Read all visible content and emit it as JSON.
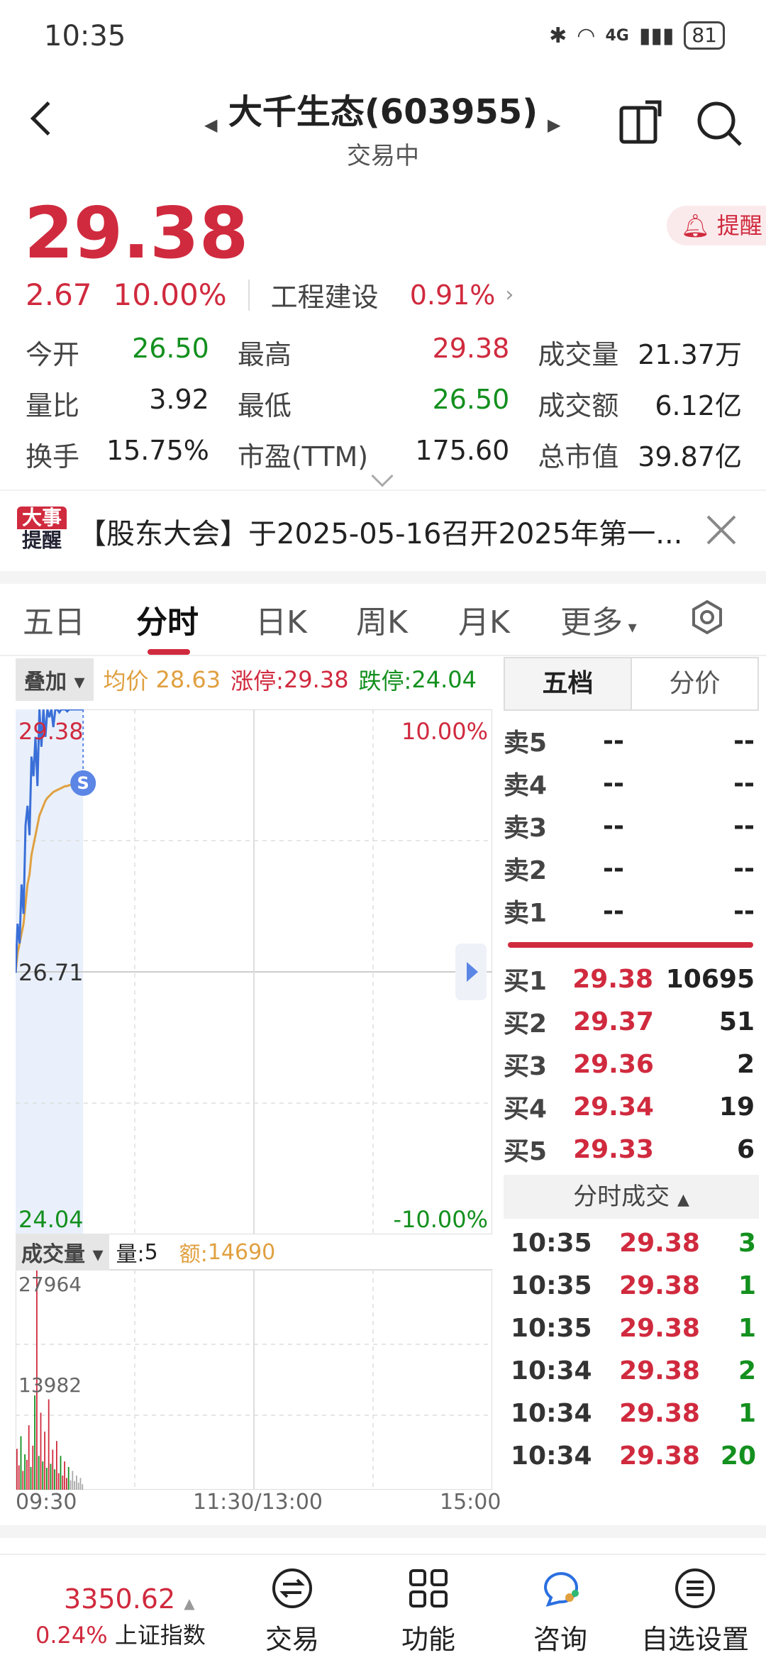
{
  "status_bar": {
    "time": "10:35",
    "network": "4G",
    "battery": "81"
  },
  "header": {
    "stock_name": "大千生态(603955)",
    "status": "交易中"
  },
  "quote": {
    "price": "29.38",
    "change": "2.67",
    "change_pct": "10.00%",
    "sector_name": "工程建设",
    "sector_pct": "0.91%",
    "alert_label": "提醒",
    "stats": [
      {
        "l1": "今开",
        "v1": "26.50",
        "l2": "最高",
        "v2": "29.38",
        "l3": "成交量",
        "v3": "21.37万"
      },
      {
        "l1": "量比",
        "v1": "3.92",
        "l2": "最低",
        "v2": "26.50",
        "l3": "成交额",
        "v3": "6.12亿"
      },
      {
        "l1": "换手",
        "v1": "15.75%",
        "l2": "市盈(TTM)",
        "v2": "175.60",
        "l3": "总市值",
        "v3": "39.87亿"
      }
    ]
  },
  "news": {
    "badge_top": "大事",
    "badge_bottom": "提醒",
    "text": "【股东大会】于2025-05-16召开2025年第一..."
  },
  "tabs": [
    "五日",
    "分时",
    "日K",
    "周K",
    "月K",
    "更多"
  ],
  "chart_info": {
    "stack_label": "叠加",
    "avg_label": "均价",
    "avg": "28.63",
    "limit_up_label": "涨停:",
    "limit_up": "29.38",
    "limit_down_label": "跌停:",
    "limit_down": "24.04"
  },
  "chart_data": {
    "type": "line",
    "y_labels": {
      "top": "29.38",
      "mid": "26.71",
      "bottom": "24.04",
      "top_pct": "10.00%",
      "bottom_pct": "-10.00%"
    },
    "ylim": [
      24.04,
      29.38
    ],
    "price": [
      26.7,
      27.2,
      27.0,
      27.6,
      27.3,
      28.2,
      28.4,
      28.1,
      28.9,
      28.7,
      29.1,
      28.6,
      29.38,
      29.0,
      29.38,
      29.1,
      29.38,
      29.3,
      29.38,
      29.2,
      29.38,
      29.38,
      29.35,
      29.38,
      29.38,
      29.38,
      29.36,
      29.38,
      29.38,
      29.38,
      29.38,
      29.38,
      29.38,
      29.38,
      29.38
    ],
    "avg": [
      26.7,
      26.9,
      27.0,
      27.1,
      27.2,
      27.4,
      27.6,
      27.7,
      27.9,
      28.0,
      28.1,
      28.2,
      28.3,
      28.35,
      28.4,
      28.45,
      28.48,
      28.5,
      28.52,
      28.54,
      28.55,
      28.56,
      28.57,
      28.58,
      28.59,
      28.6,
      28.6,
      28.61,
      28.61,
      28.62,
      28.62,
      28.62,
      28.63,
      28.63,
      28.63
    ],
    "marker": "S",
    "volume_label": "成交量",
    "vol_label": "量:",
    "vol": "5",
    "amount_label": "额:",
    "amount": "14690",
    "vol_max_label": "27964",
    "vol_mid_label": "13982",
    "vol_ylim": [
      0,
      27964
    ],
    "volumes": [
      5200,
      3100,
      6800,
      2400,
      4500,
      3800,
      8200,
      2900,
      5600,
      12000,
      27964,
      4300,
      9800,
      3600,
      7400,
      2800,
      11500,
      3300,
      5100,
      2600,
      6200,
      2100,
      4300,
      1800,
      3600,
      1500,
      2900,
      1200,
      2400,
      1100,
      1800,
      900,
      1500,
      700,
      5
    ],
    "time_labels": [
      "09:30",
      "11:30/13:00",
      "15:00"
    ]
  },
  "orderbook": {
    "tab_active": "五档",
    "tab_other": "分价",
    "asks": [
      {
        "label": "卖5",
        "price": "--",
        "vol": "--"
      },
      {
        "label": "卖4",
        "price": "--",
        "vol": "--"
      },
      {
        "label": "卖3",
        "price": "--",
        "vol": "--"
      },
      {
        "label": "卖2",
        "price": "--",
        "vol": "--"
      },
      {
        "label": "卖1",
        "price": "--",
        "vol": "--"
      }
    ],
    "bids": [
      {
        "label": "买1",
        "price": "29.38",
        "vol": "10695"
      },
      {
        "label": "买2",
        "price": "29.37",
        "vol": "51"
      },
      {
        "label": "买3",
        "price": "29.36",
        "vol": "2"
      },
      {
        "label": "买4",
        "price": "29.34",
        "vol": "19"
      },
      {
        "label": "买5",
        "price": "29.33",
        "vol": "6"
      }
    ],
    "ticks_header": "分时成交",
    "ticks": [
      {
        "time": "10:35",
        "price": "29.38",
        "vol": "3"
      },
      {
        "time": "10:35",
        "price": "29.38",
        "vol": "1"
      },
      {
        "time": "10:35",
        "price": "29.38",
        "vol": "1"
      },
      {
        "time": "10:34",
        "price": "29.38",
        "vol": "2"
      },
      {
        "time": "10:34",
        "price": "29.38",
        "vol": "1"
      },
      {
        "time": "10:34",
        "price": "29.38",
        "vol": "20"
      }
    ]
  },
  "bottom_nav": {
    "index_value": "3350.62",
    "index_pct": "0.24%",
    "index_name": "上证指数",
    "items": [
      "交易",
      "功能",
      "咨询",
      "自选设置"
    ]
  },
  "colors": {
    "up": "#d02a3e",
    "down": "#13901e",
    "price_line": "#3a6fd8",
    "avg_line": "#e0a040"
  }
}
